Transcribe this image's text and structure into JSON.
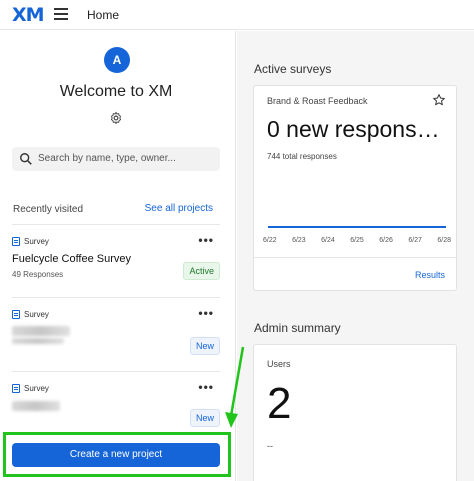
{
  "topbar": {
    "logo": "XM",
    "home": "Home",
    "icons": [
      "hamburger-menu-icon"
    ]
  },
  "left": {
    "avatar_letter": "A",
    "welcome": "Welcome to XM",
    "search_placeholder": "Search by name, type, owner...",
    "recently_visited": "Recently visited",
    "see_all": "See all projects",
    "projects": [
      {
        "type": "Survey",
        "title": "Fuelcycle Coffee Survey",
        "subtitle": "49 Responses",
        "badge": "Active"
      },
      {
        "type": "Survey",
        "title": "",
        "subtitle": "",
        "badge": "New"
      },
      {
        "type": "Survey",
        "title": "",
        "subtitle": "",
        "badge": "New"
      }
    ],
    "create_button": "Create a new project"
  },
  "right": {
    "active_surveys_title": "Active surveys",
    "survey_card": {
      "name": "Brand & Roast Feedback",
      "headline": "0 new respons…",
      "total": "744 total responses",
      "dates": [
        "6/22",
        "6/23",
        "6/24",
        "6/25",
        "6/26",
        "6/27",
        "6/28"
      ],
      "results_link": "Results"
    },
    "admin_summary_title": "Admin summary",
    "admin_card": {
      "label": "Users",
      "value": "2",
      "dash": "--"
    }
  },
  "colors": {
    "accent": "#1565d8",
    "highlight": "#21c41a",
    "active_badge": "#1f7a2b"
  }
}
